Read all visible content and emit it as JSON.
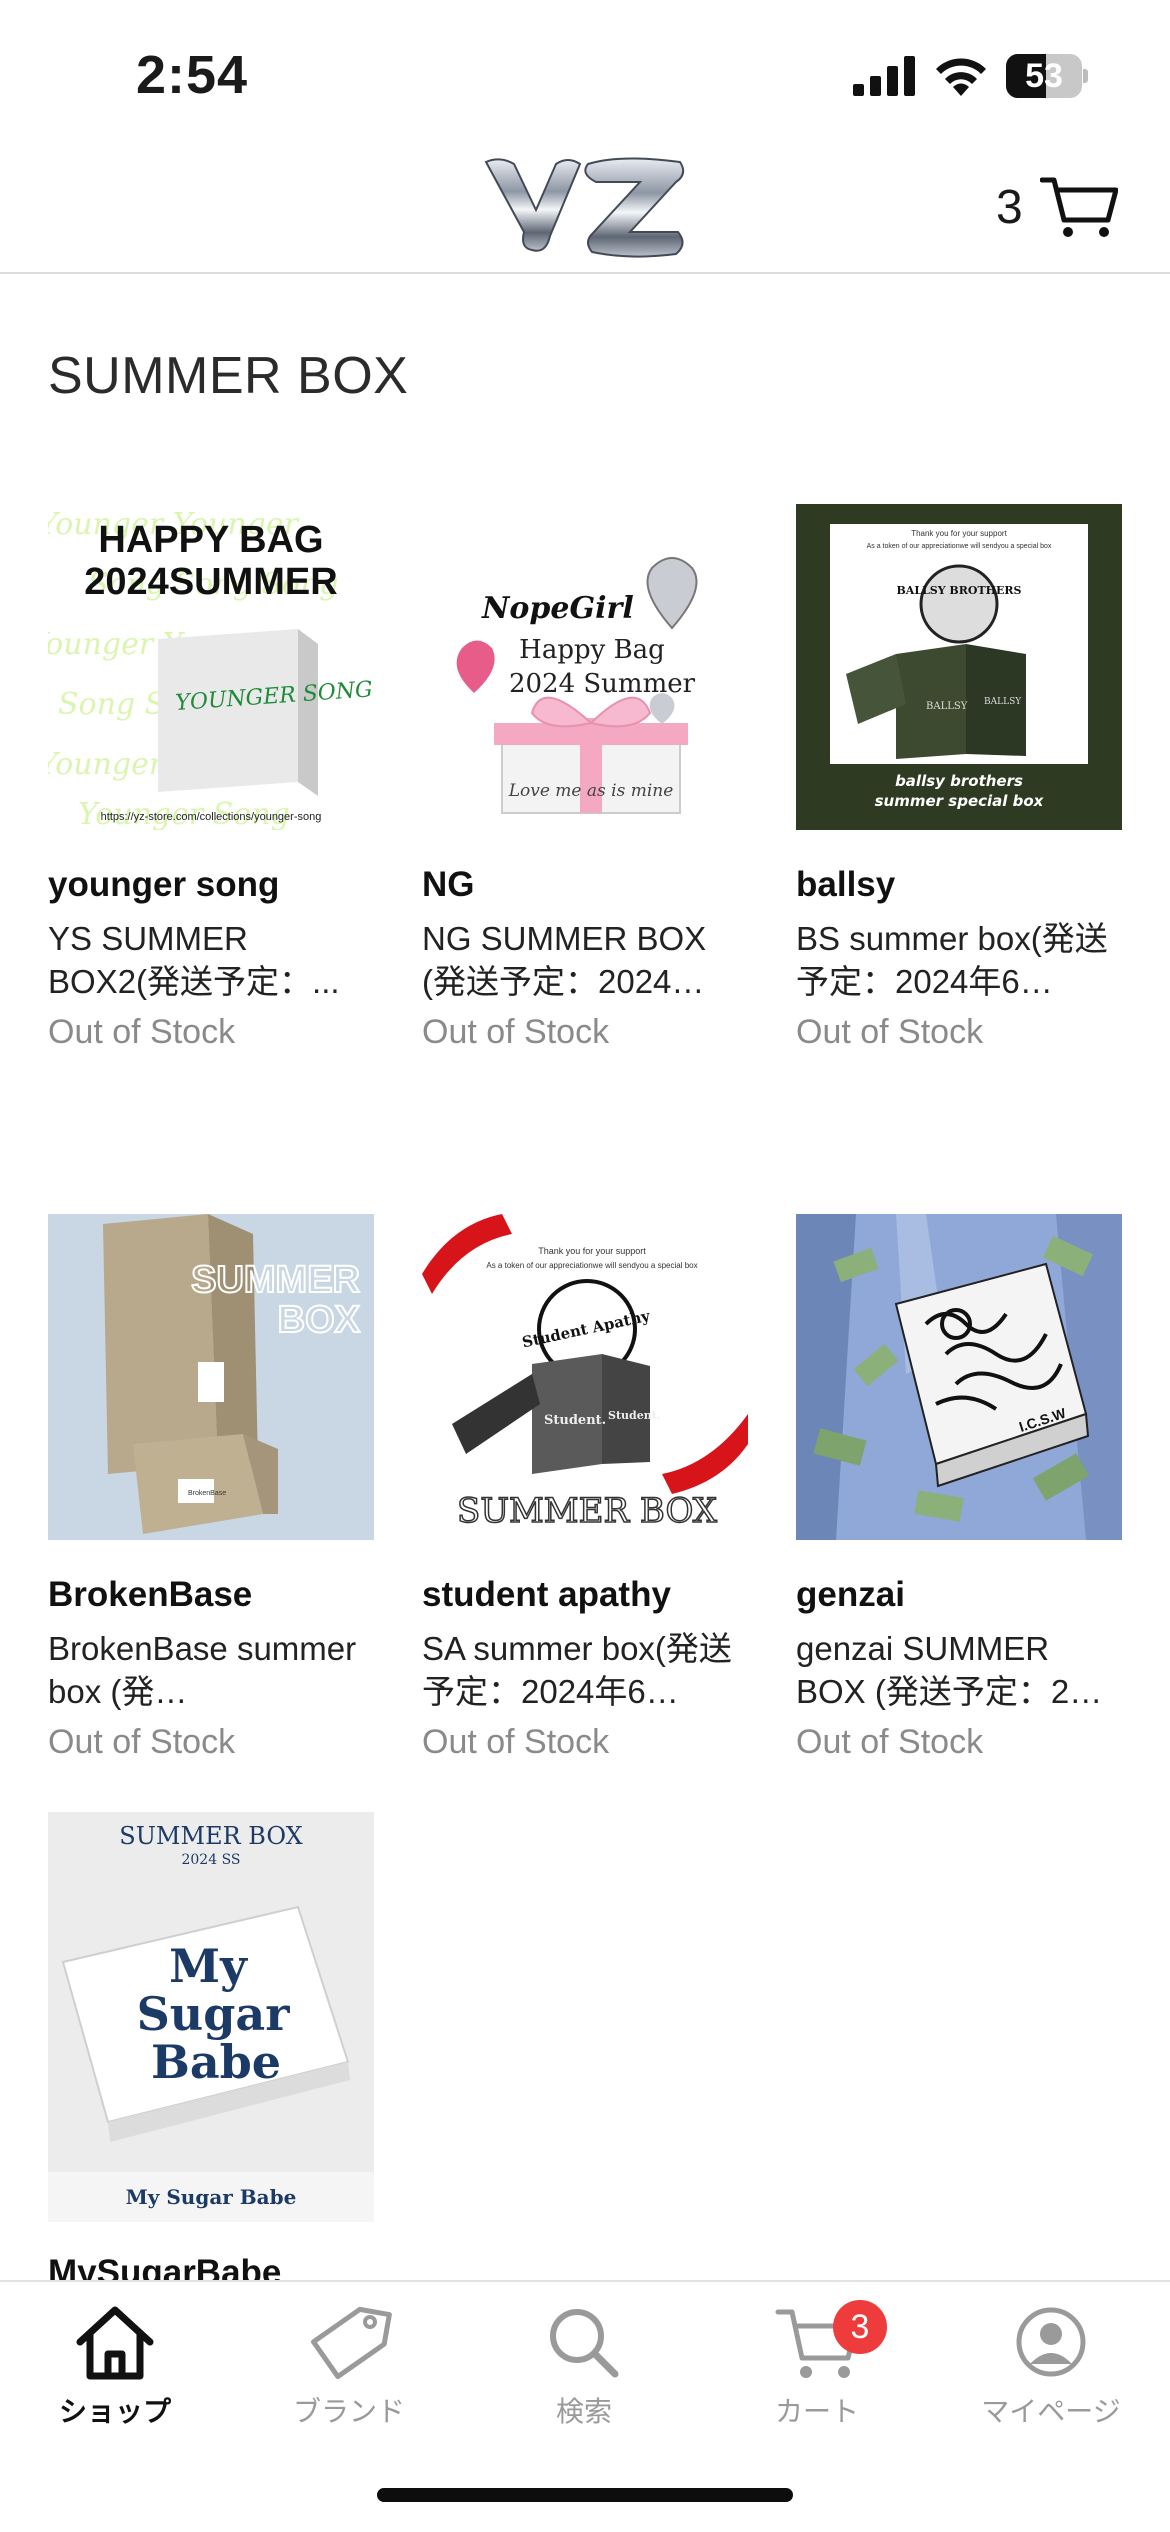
{
  "status": {
    "time": "2:54",
    "battery": "53",
    "battery_level": 0.53
  },
  "header": {
    "cart_count": "3"
  },
  "section_title": "SUMMER BOX",
  "products": [
    {
      "brand": "younger song",
      "name": "YS SUMMER BOX2(発送予定：...",
      "stock": "Out of Stock",
      "image_text": {
        "headline1": "HAPPY BAG",
        "headline2": "2024SUMMER",
        "logo": "YOUNGER SONG",
        "url": "https://yz-store.com/collections/younger-song"
      }
    },
    {
      "brand": "NG",
      "name": "NG SUMMER BOX (発送予定：2024…",
      "stock": "Out of Stock",
      "image_text": {
        "logo": "NopeGirl",
        "line1": "Happy Bag",
        "line2": "2024 Summer",
        "tagline": "Love me as is mine"
      }
    },
    {
      "brand": "ballsy",
      "name": "BS summer box(発送予定：2024年6…",
      "stock": "Out of Stock",
      "image_text": {
        "thanks": "Thank you for your support",
        "token": "As a token of our appreciationwe will sendyou a special box",
        "logo": "BALLSY BROTHERS",
        "caption1": "ballsy brothers",
        "caption2": "summer special box"
      }
    },
    {
      "brand": "BrokenBase",
      "name": "BrokenBase summer box (発…",
      "stock": "Out of Stock",
      "image_text": {
        "line1": "SUMMER",
        "line2": "BOX",
        "label": "BrokenBase"
      }
    },
    {
      "brand": "student apathy",
      "name": "SA summer box(発送予定：2024年6…",
      "stock": "Out of Stock",
      "image_text": {
        "thanks": "Thank you for your support",
        "token": "As a token of our appreciationwe will sendyou a special box",
        "logo": "Student Apathy",
        "caption": "SUMMER BOX"
      }
    },
    {
      "brand": "genzai",
      "name": "genzai SUMMER BOX (発送予定：2…",
      "stock": "Out of Stock",
      "image_text": {
        "label": "I.C.S.W"
      }
    },
    {
      "brand": "MySugarBabe",
      "name": "",
      "stock": "",
      "image_text": {
        "title": "SUMMER BOX",
        "season": "2024 SS",
        "logo1": "My",
        "logo2": "Sugar",
        "logo3": "Babe",
        "footer": "My Sugar Babe"
      }
    }
  ],
  "tabs": [
    {
      "label": "ショップ",
      "icon": "home-icon",
      "active": true
    },
    {
      "label": "ブランド",
      "icon": "tag-icon",
      "active": false
    },
    {
      "label": "検索",
      "icon": "search-icon",
      "active": false
    },
    {
      "label": "カート",
      "icon": "cart-icon",
      "active": false,
      "badge": "3"
    },
    {
      "label": "マイページ",
      "icon": "user-icon",
      "active": false
    }
  ],
  "colors": {
    "badge": "#ee3b3b",
    "out_of_stock": "#8a8a8a",
    "accent_green": "#1f8a3a"
  }
}
